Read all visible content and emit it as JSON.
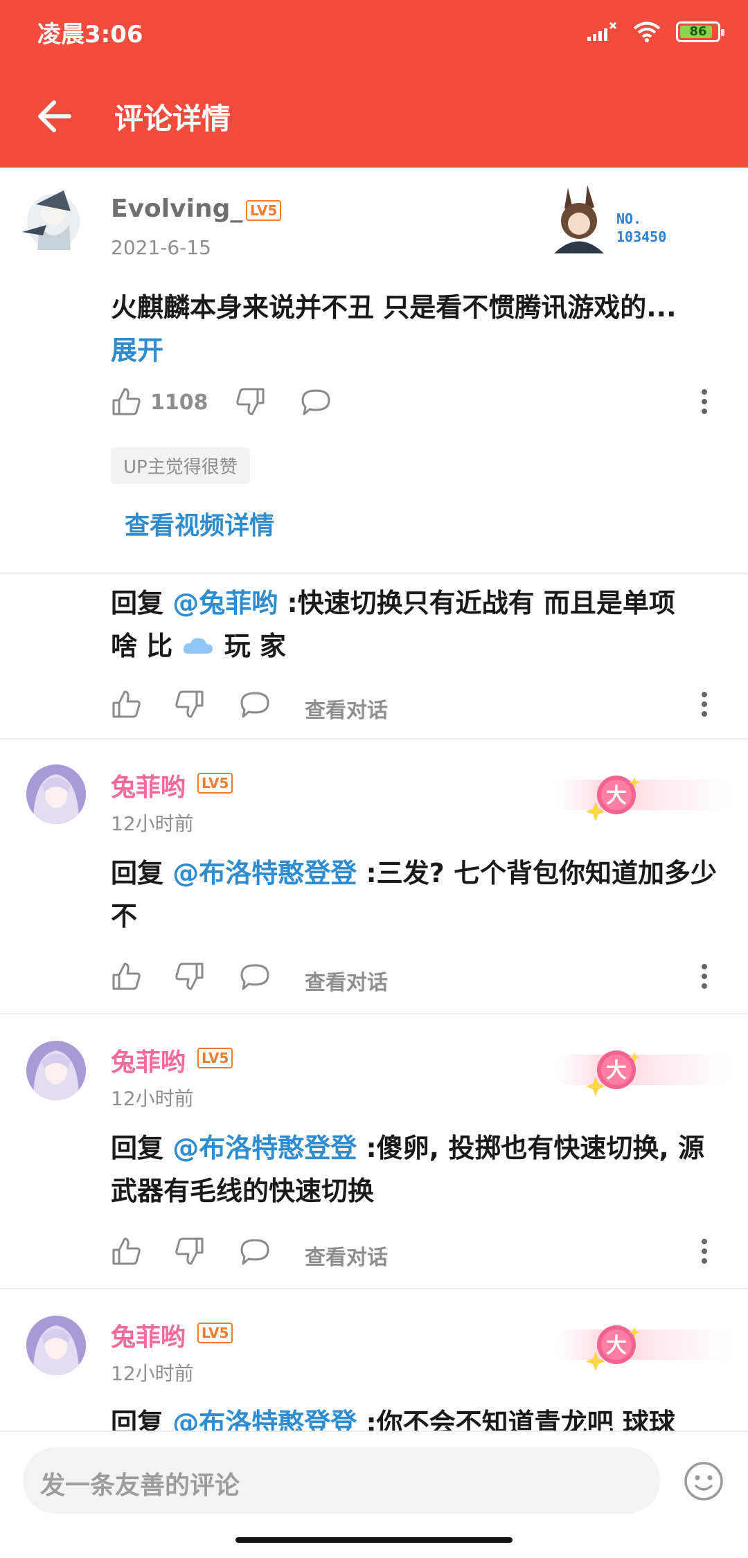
{
  "status": {
    "time": "凌晨3:06",
    "battery": "86"
  },
  "appbar": {
    "title": "评论详情"
  },
  "main_comment": {
    "username": "Evolving_",
    "level": "LV5",
    "date": "2021-6-15",
    "text": "火麒麟本身来说并不丑  只是看不惯腾讯游戏的...",
    "expand": "展开",
    "likes": "1108",
    "tag": "UP主觉得很赞",
    "view_video": "查看视频详情",
    "badge_no_label": "NO.",
    "badge_no_value": "103450"
  },
  "reply1": {
    "prefix": "回复 ",
    "mention": "@兔菲哟",
    "text_a": " :快速切换只有近战有 而且是单项",
    "text_b": "啥 比",
    "text_c": " 玩 家",
    "view_dialog": "查看对话"
  },
  "replies": [
    {
      "username": "兔菲哟",
      "level": "LV5",
      "time": "12小时前",
      "prefix": "回复 ",
      "mention": "@布洛特憨登登",
      "text": " :三发? 七个背包你知道加多少不",
      "view_dialog": "查看对话",
      "badge_char": "大"
    },
    {
      "username": "兔菲哟",
      "level": "LV5",
      "time": "12小时前",
      "prefix": "回复 ",
      "mention": "@布洛特憨登登",
      "text": " :傻卵, 投掷也有快速切换, 源武器有毛线的快速切换",
      "view_dialog": "查看对话",
      "badge_char": "大"
    },
    {
      "username": "兔菲哟",
      "level": "LV5",
      "time": "12小时前",
      "prefix": "回复 ",
      "mention": "@布洛特憨登登",
      "text": " :你不会不知道青龙吧  球球",
      "badge_char": "大"
    }
  ],
  "bottom": {
    "placeholder": "发一条友善的评论"
  },
  "colors": {
    "accent": "#f04b3c",
    "link": "#2f8ccf",
    "pink_name": "#f06a9e",
    "level": "#ee7c2f"
  }
}
